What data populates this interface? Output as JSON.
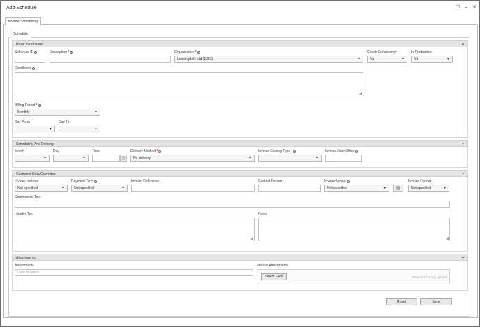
{
  "window": {
    "title": "Add Schedule",
    "maximize_icon": "☐",
    "minimize_icon": "–",
    "close_icon": "✕"
  },
  "outer_tab": "Invoice Scheduling",
  "inner_tab": "Schedule",
  "basic": {
    "title": "Basic Information",
    "schedule_id": "Schedule ID",
    "description": "Description",
    "organization": "Organization",
    "organization_value": "Leasingdale Ltd (1282)",
    "check_consistency": "Check Consistency",
    "check_consistency_value": "No",
    "in_production": "In Production",
    "in_production_value": "No",
    "conditions": "Conditions",
    "billing_period": "Billing Period",
    "billing_period_value": "Monthly",
    "day_from": "Day From",
    "day_to": "Day To"
  },
  "scheduling": {
    "title": "Scheduling And Delivery",
    "month": "Month",
    "day": "Day",
    "time": "Time",
    "delivery_method": "Delivery Method",
    "delivery_method_value": "No delivery",
    "invoice_closing_type": "Invoice Closing Type",
    "invoice_date_offset": "Invoice Date Offset"
  },
  "overrides": {
    "title": "Customer Data Overrides",
    "invoice_method": "Invoice method",
    "invoice_method_value": "Not specified",
    "payment_term": "Payment Term",
    "payment_term_value": "Not specified",
    "invoice_reference": "Invoice Reference",
    "contact_person": "Contact Person",
    "invoice_layout": "Invoice layout",
    "invoice_layout_value": "Not specified",
    "invoice_format": "Invoice Format",
    "invoice_format_value": "Not specified",
    "commercial_text": "Commercial Text",
    "header_text": "Header Text",
    "notes": "Notes"
  },
  "attachments": {
    "title": "Attachments",
    "attachments_label": "Attachments",
    "attachments_placeholder": "Click to select",
    "manual_attachments": "Manual Attachments",
    "select_files": "Select Files",
    "drop_text": "Drop files here to upload"
  },
  "footer": {
    "reset": "Reset",
    "save": "Save"
  },
  "icons": {
    "collapse": "▲",
    "dropdown": "▼",
    "clock": "◷",
    "layout": "▤",
    "resize": "◢",
    "info": "i"
  }
}
